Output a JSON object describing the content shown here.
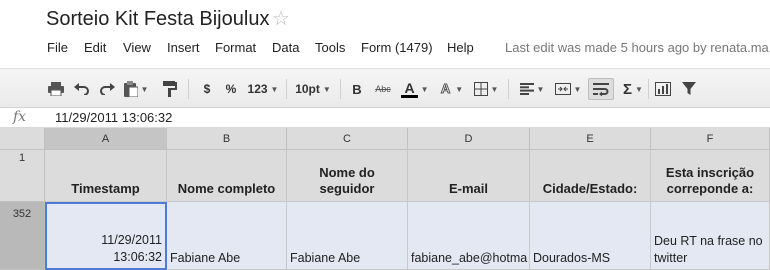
{
  "document": {
    "title": "Sorteio Kit Festa Bijoulux"
  },
  "menu": {
    "items": [
      "File",
      "Edit",
      "View",
      "Insert",
      "Format",
      "Data",
      "Tools",
      "Form (1479)",
      "Help"
    ],
    "last_edit": "Last edit was made 5 hours ago by renata.ma"
  },
  "toolbar": {
    "currency_label": "$",
    "percent_label": "%",
    "number_format_label": "123",
    "font_size_label": "10pt",
    "bold_label": "B",
    "strike_label": "Abc",
    "text_color_label": "A",
    "fill_color_label": "A",
    "text_color_swatch": "#000000",
    "wrap_active": true
  },
  "formula_bar": {
    "fx_label": "fx",
    "value": "11/29/2011 13:06:32"
  },
  "grid": {
    "columns": [
      "A",
      "B",
      "C",
      "D",
      "E",
      "F"
    ],
    "rows": [
      {
        "number": "1",
        "cells": [
          "Timestamp",
          "Nome completo",
          "Nome do seguidor",
          "E-mail",
          "Cidade/Estado:",
          "Esta inscrição correponde a:"
        ]
      },
      {
        "number": "352",
        "cells": [
          "11/29/2011 13:06:32",
          "Fabiane Abe",
          "Fabiane Abe",
          "fabiane_abe@hotma",
          "Dourados-MS",
          "Deu RT na frase no twitter"
        ]
      }
    ],
    "selected_cell": "A352",
    "colors": {
      "header_bg": "#dcdcdc",
      "data_bg": "#e3e8f3",
      "selection_border": "#4d7bd6"
    }
  }
}
